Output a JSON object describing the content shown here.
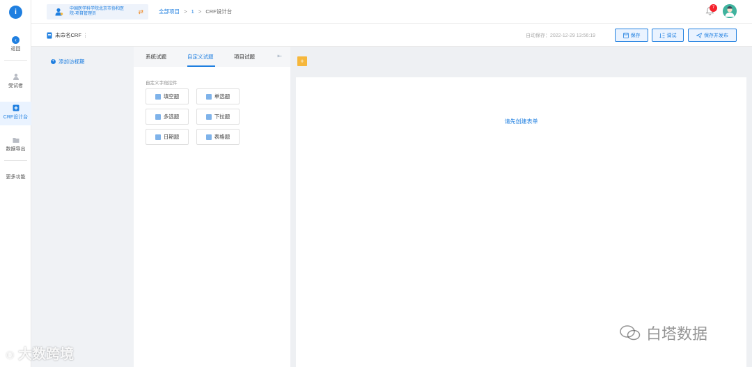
{
  "rail": {
    "back_label": "返回",
    "items": [
      {
        "label": "受试者",
        "icon": "users-icon"
      },
      {
        "label": "CRF设计台",
        "icon": "crf-design-icon"
      },
      {
        "label": "数据导出",
        "icon": "folder-export-icon"
      },
      {
        "label": "更多功能",
        "icon": ""
      }
    ]
  },
  "topbar": {
    "org_name": "中国医学科学院北京市协和医院-项目管理员",
    "breadcrumb": {
      "root": "全部项目",
      "project": "1",
      "current": "CRF设计台",
      "separator": ">"
    },
    "notification_count": "7"
  },
  "subbar": {
    "crf_name": "未命名CRF",
    "more_glyph": "⋮",
    "autosave": "自动保存：2022-12-29 13:56:19",
    "save_label": "保存",
    "test_label": "调试",
    "publish_label": "保存并发布"
  },
  "visit": {
    "add_label": "添加访视期"
  },
  "panel": {
    "tabs": [
      {
        "label": "系统试题",
        "active": false
      },
      {
        "label": "自定义试题",
        "active": true
      },
      {
        "label": "项目试题",
        "active": false
      }
    ],
    "section_title": "自定义字段控件",
    "controls": [
      {
        "label": "填空题",
        "icon": "fill-blank-icon"
      },
      {
        "label": "单选题",
        "icon": "single-choice-icon"
      },
      {
        "label": "多选题",
        "icon": "multi-choice-icon"
      },
      {
        "label": "下拉题",
        "icon": "dropdown-icon"
      },
      {
        "label": "日期题",
        "icon": "date-icon"
      },
      {
        "label": "表格题",
        "icon": "table-icon"
      }
    ]
  },
  "canvas": {
    "empty_tip": "请先创建表单"
  },
  "watermarks": {
    "left": "大数跨境",
    "right": "白塔数据"
  },
  "colors": {
    "accent": "#1f7fe0",
    "warning": "#f6b73c",
    "badge": "#f5222d"
  }
}
